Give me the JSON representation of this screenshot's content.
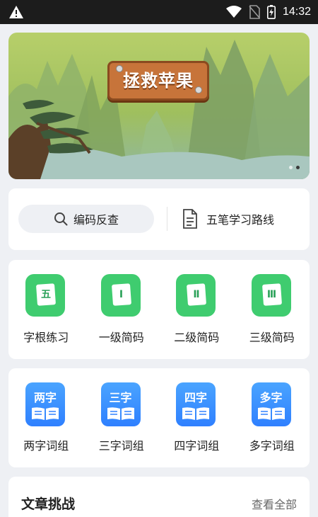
{
  "status_bar": {
    "time": "14:32"
  },
  "banner": {
    "title": "拯救苹果",
    "dot_count": 2,
    "active_dot": 2
  },
  "search": {
    "reverse_lookup_label": "编码反查",
    "route_label": "五笔学习路线"
  },
  "practice": {
    "items": [
      {
        "icon_char": "五",
        "label": "字根练习"
      },
      {
        "icon_char": "Ⅰ",
        "label": "一级简码"
      },
      {
        "icon_char": "Ⅱ",
        "label": "二级简码"
      },
      {
        "icon_char": "Ⅲ",
        "label": "三级简码"
      }
    ]
  },
  "phrases": {
    "items": [
      {
        "icon_char": "两字",
        "label": "两字词组"
      },
      {
        "icon_char": "三字",
        "label": "三字词组"
      },
      {
        "icon_char": "四字",
        "label": "四字词组"
      },
      {
        "icon_char": "多字",
        "label": "多字词组"
      }
    ]
  },
  "articles": {
    "title": "文章挑战",
    "more_label": "查看全部"
  },
  "colors": {
    "green_icon": "#3fcc6f",
    "blue_icon": "#2f80ff",
    "background": "#eef0f4"
  }
}
